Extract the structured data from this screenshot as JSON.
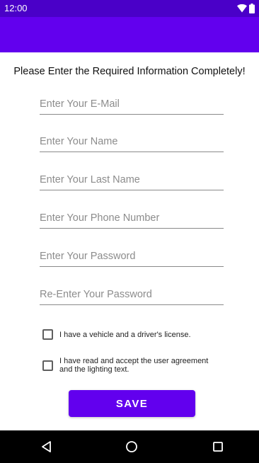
{
  "status_bar": {
    "time": "12:00",
    "icons": [
      "wifi-icon",
      "battery-icon"
    ],
    "color": "#4a00c8"
  },
  "app_bar": {
    "color": "#6200ee"
  },
  "form": {
    "heading": "Please Enter the Required Information Completely!",
    "fields": [
      {
        "placeholder": "Enter Your E-Mail",
        "value": ""
      },
      {
        "placeholder": "Enter Your Name",
        "value": ""
      },
      {
        "placeholder": "Enter Your Last Name",
        "value": ""
      },
      {
        "placeholder": "Enter Your Phone Number",
        "value": ""
      },
      {
        "placeholder": "Enter Your Password",
        "value": ""
      },
      {
        "placeholder": "Re-Enter Your Password",
        "value": ""
      }
    ],
    "checkboxes": [
      {
        "label": "I have a vehicle and a driver's license.",
        "checked": false
      },
      {
        "label_line1": "I have read and accept the user agreement",
        "label_line2": "and the lighting text.",
        "checked": false
      }
    ],
    "save_label": "SAVE",
    "accent_color": "#6200ee"
  },
  "nav_bar": {
    "icons": [
      "back-icon",
      "home-icon",
      "recents-icon"
    ]
  }
}
